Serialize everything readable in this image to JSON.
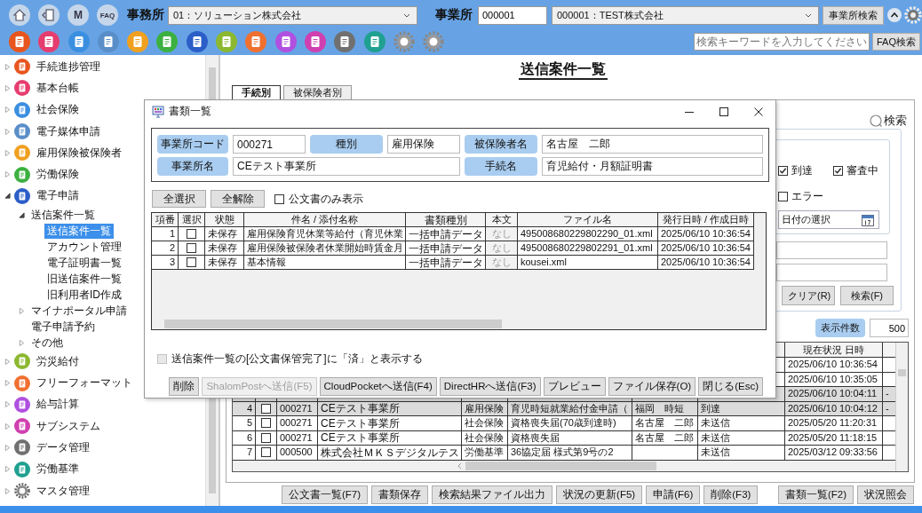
{
  "toolbar": {
    "nav_icons": [
      {
        "kind": "home"
      },
      {
        "kind": "panel"
      },
      {
        "kind": "book",
        "label": "M"
      },
      {
        "kind": "bubble",
        "label": "FAQ"
      }
    ],
    "office_label": "事務所",
    "office_select": "01：ソリューション株式会社",
    "site_label": "事業所",
    "site_code": "000001",
    "site_select": "000001：TEST株式会社",
    "site_search_button": "事業所検索",
    "app_icons": [
      {
        "kind": "app",
        "color": "#e8561e"
      },
      {
        "kind": "app",
        "color": "#e63d6e"
      },
      {
        "kind": "app",
        "color": "#3b8fe0"
      },
      {
        "kind": "app",
        "color": "#5a8ec8"
      },
      {
        "kind": "app",
        "color": "#f0a020"
      },
      {
        "kind": "app",
        "color": "#3cb040"
      },
      {
        "kind": "app",
        "color": "#2c5ec8"
      },
      {
        "kind": "app",
        "color": "#8cb830"
      },
      {
        "kind": "app",
        "color": "#f07030"
      },
      {
        "kind": "app",
        "color": "#b050e0"
      },
      {
        "kind": "app",
        "color": "#d040b0"
      },
      {
        "kind": "app",
        "color": "#707070"
      },
      {
        "kind": "app",
        "color": "#20a090"
      },
      {
        "kind": "gear"
      },
      {
        "kind": "gear"
      }
    ],
    "faq_search": {
      "placeholder": "検索キーワードを入力してください",
      "button": "FAQ検索"
    }
  },
  "sidebar": {
    "items": [
      {
        "label": "手続進捗管理",
        "kind": "app",
        "color": "#e8561e",
        "expanded": false
      },
      {
        "label": "基本台帳",
        "kind": "app",
        "color": "#e63d6e",
        "expanded": false
      },
      {
        "label": "社会保険",
        "kind": "app",
        "color": "#3b8fe0",
        "expanded": false
      },
      {
        "label": "電子媒体申請",
        "kind": "app",
        "color": "#5a8ec8",
        "expanded": false
      },
      {
        "label": "雇用保険被保険者",
        "kind": "app",
        "color": "#f0a020",
        "expanded": false
      },
      {
        "label": "労働保険",
        "kind": "app",
        "color": "#3cb040",
        "expanded": false
      },
      {
        "label": "電子申請",
        "kind": "app",
        "color": "#2c5ec8",
        "expanded": true,
        "children": [
          {
            "label": "送信案件一覧",
            "expanded": true,
            "children": [
              {
                "label": "送信案件一覧",
                "selected": true
              },
              {
                "label": "アカウント管理",
                "selected": false
              },
              {
                "label": "電子証明書一覧",
                "selected": false
              },
              {
                "label": "旧送信案件一覧",
                "selected": false
              },
              {
                "label": "旧利用者ID作成",
                "selected": false
              }
            ]
          },
          {
            "label": "マイナポータル申請",
            "expanded": false
          },
          {
            "label": "電子申請予約",
            "selected": false
          },
          {
            "label": "その他",
            "expanded": false
          }
        ]
      },
      {
        "label": "労災給付",
        "kind": "app",
        "color": "#8cb830",
        "expanded": false
      },
      {
        "label": "フリーフォーマット",
        "kind": "app",
        "color": "#f07030",
        "expanded": false
      },
      {
        "label": "給与計算",
        "kind": "app",
        "color": "#b050e0",
        "expanded": false
      },
      {
        "label": "サブシステム",
        "kind": "app",
        "color": "#d040b0",
        "expanded": false
      },
      {
        "label": "データ管理",
        "kind": "app",
        "color": "#707070",
        "expanded": false
      },
      {
        "label": "労働基準",
        "kind": "app",
        "color": "#20a090",
        "expanded": false
      },
      {
        "label": "マスタ管理",
        "kind": "gear",
        "expanded": false
      }
    ]
  },
  "main": {
    "page_title": "送信案件一覧",
    "tabs": [
      {
        "label": "手続別",
        "selected": true
      },
      {
        "label": "被保険者別",
        "selected": false
      }
    ],
    "search_panel": {
      "title": "検索",
      "status_filters": [
        {
          "label": "到達",
          "checked": true
        },
        {
          "label": "審査中",
          "checked": true
        },
        {
          "label": "エラー",
          "checked": false
        }
      ],
      "date_placeholder": "日付の選択",
      "buttons": [
        "クリア(R)",
        "検索(F)"
      ]
    },
    "display_count": {
      "label": "表示件数",
      "value": "500"
    },
    "results": {
      "header_datetime": "現在状況 日時",
      "rows": [
        {
          "selected": false,
          "datetime": "2025/06/10 10:36:54"
        },
        {
          "selected": false,
          "datetime": "2025/06/10 10:35:05"
        },
        {
          "selected": true,
          "datetime": "2025/06/10 10:04:11",
          "extra": "-"
        },
        {
          "selected": true,
          "no": "4",
          "checked": false,
          "code": "000271",
          "office": "CEテスト事業所",
          "type": "雇用保険",
          "procedure": "育児時短就業給付金申請（",
          "insured": "福岡　時短",
          "status": "到達",
          "datetime": "2025/06/10 10:04:12",
          "extra": "-"
        },
        {
          "selected": false,
          "no": "5",
          "checked": false,
          "code": "000271",
          "office": "CEテスト事業所",
          "type": "社会保険",
          "procedure": "資格喪失届(70歳到達時)",
          "insured": "名古屋　二郎",
          "status": "未送信",
          "datetime": "2025/05/20 11:20:31"
        },
        {
          "selected": false,
          "no": "6",
          "checked": false,
          "code": "000271",
          "office": "CEテスト事業所",
          "type": "社会保険",
          "procedure": "資格喪失届",
          "insured": "名古屋　二郎",
          "status": "未送信",
          "datetime": "2025/05/20 11:18:15"
        },
        {
          "selected": false,
          "no": "7",
          "checked": false,
          "code": "000500",
          "office": "株式会社ＭＫＳデジタルテス",
          "type": "労働基準",
          "procedure": "36協定届 様式第9号の2",
          "status": "未送信",
          "datetime": "2025/03/12 09:33:56"
        }
      ]
    },
    "bottom_buttons": [
      "公文書一覧(F7)",
      "書類保存",
      "検索結果ファイル出力",
      "状況の更新(F5)",
      "申請(F6)",
      "削除(F3)"
    ],
    "right_buttons": [
      "書類一覧(F2)",
      "状況照会"
    ]
  },
  "dialog": {
    "title": "書類一覧",
    "fields": [
      [
        {
          "label": "事業所コード",
          "value": "000271"
        },
        {
          "label": "種別",
          "value": "雇用保険"
        },
        {
          "label": "被保険者名",
          "value": "名古屋　二郎"
        }
      ],
      [
        {
          "label": "事業所名",
          "value": "CEテスト事業所"
        },
        {
          "label": "手続名",
          "value": "育児給付・月額証明書"
        }
      ]
    ],
    "select_all": "全選択",
    "clear_all": "全解除",
    "official_only": {
      "label": "公文書のみ表示",
      "checked": false
    },
    "columns": [
      "項番",
      "選択",
      "状態",
      "件名 / 添付名称",
      "書類種別",
      "本文",
      "ファイル名",
      "発行日時 / 作成日時"
    ],
    "rows": [
      {
        "no": "1",
        "checked": false,
        "state": "未保存",
        "subject": "雇用保険育児休業等給付（育児休業",
        "doc_type": "一括申請データ",
        "body": "なし",
        "file": "495008680229802290_01.xml",
        "date": "2025/06/10 10:36:54"
      },
      {
        "no": "2",
        "checked": false,
        "state": "未保存",
        "subject": "雇用保険被保険者休業開始時賃金月",
        "doc_type": "一括申請データ",
        "body": "なし",
        "file": "495008680229802291_01.xml",
        "date": "2025/06/10 10:36:54"
      },
      {
        "no": "3",
        "checked": false,
        "state": "未保存",
        "subject": "基本情報",
        "doc_type": "一括申請データ",
        "body": "なし",
        "file": "kousei.xml",
        "date": "2025/06/10 10:36:54"
      }
    ],
    "show_done": {
      "label": "送信案件一覧の[公文書保管完了]に「済」と表示する",
      "checked": false,
      "disabled": true
    },
    "buttons": [
      {
        "label": "削除",
        "disabled": false
      },
      {
        "label": "ShalomPostへ送信(F5)",
        "disabled": true
      },
      {
        "label": "CloudPocketへ送信(F4)",
        "disabled": false
      },
      {
        "label": "DirectHRへ送信(F3)",
        "disabled": false
      },
      {
        "label": "プレビュー",
        "disabled": false
      },
      {
        "label": "ファイル保存(O)",
        "disabled": false
      },
      {
        "label": "閉じる(Esc)",
        "disabled": false
      }
    ]
  }
}
